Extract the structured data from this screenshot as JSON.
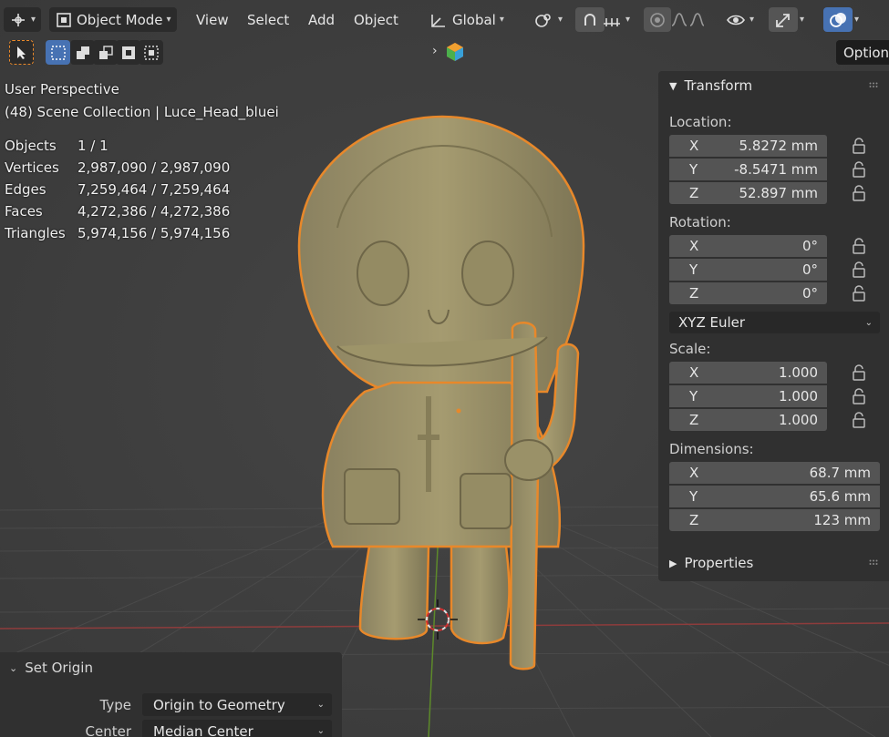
{
  "header": {
    "editor_icon": "3d-viewport-icon",
    "mode_label": "Object Mode",
    "menus": [
      "View",
      "Select",
      "Add",
      "Object"
    ],
    "orientation_label": "Global",
    "options_tab_label": "Options"
  },
  "overlay_info": {
    "view_name": "User Perspective",
    "collection_line": "(48) Scene Collection | Luce_Head_bluei"
  },
  "stats": [
    {
      "label": "Objects",
      "value": "1 / 1"
    },
    {
      "label": "Vertices",
      "value": "2,987,090 / 2,987,090"
    },
    {
      "label": "Edges",
      "value": "7,259,464 / 7,259,464"
    },
    {
      "label": "Faces",
      "value": "4,272,386 / 4,272,386"
    },
    {
      "label": "Triangles",
      "value": "5,974,156 / 5,974,156"
    }
  ],
  "transform": {
    "title": "Transform",
    "location_label": "Location:",
    "location": [
      {
        "axis": "X",
        "value": "5.8272 mm"
      },
      {
        "axis": "Y",
        "value": "-8.5471 mm"
      },
      {
        "axis": "Z",
        "value": "52.897 mm"
      }
    ],
    "rotation_label": "Rotation:",
    "rotation": [
      {
        "axis": "X",
        "value": "0°"
      },
      {
        "axis": "Y",
        "value": "0°"
      },
      {
        "axis": "Z",
        "value": "0°"
      }
    ],
    "rotation_mode": "XYZ Euler",
    "scale_label": "Scale:",
    "scale": [
      {
        "axis": "X",
        "value": "1.000"
      },
      {
        "axis": "Y",
        "value": "1.000"
      },
      {
        "axis": "Z",
        "value": "1.000"
      }
    ],
    "dimensions_label": "Dimensions:",
    "dimensions": [
      {
        "axis": "X",
        "value": "68.7 mm"
      },
      {
        "axis": "Y",
        "value": "65.6 mm"
      },
      {
        "axis": "Z",
        "value": "123 mm"
      }
    ]
  },
  "properties": {
    "title": "Properties"
  },
  "operator_panel": {
    "title": "Set Origin",
    "type_label": "Type",
    "type_value": "Origin to Geometry",
    "center_label": "Center",
    "center_value": "Median Center"
  },
  "colors": {
    "accent": "#4772b3",
    "selection_outline": "#e8882a",
    "model": "#9a9168",
    "x_axis": "#9c3d3d",
    "y_axis": "#6a9a2a"
  }
}
